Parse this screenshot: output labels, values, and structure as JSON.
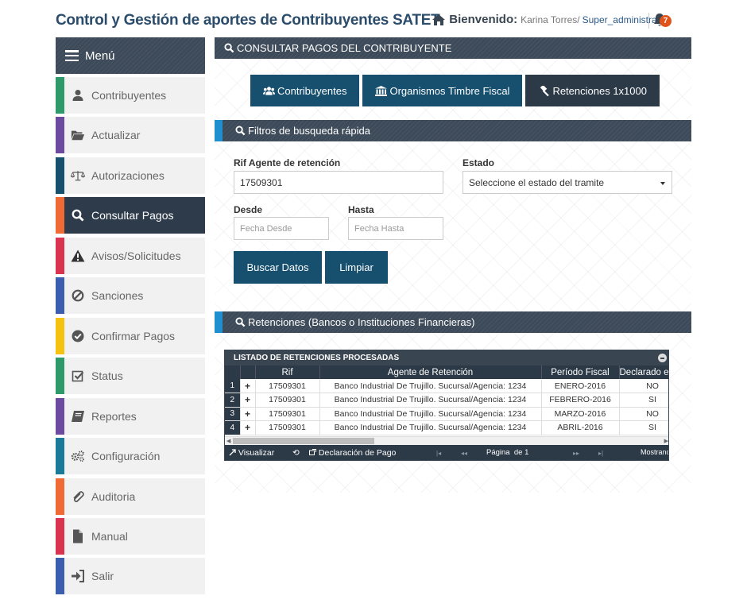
{
  "header": {
    "app_title": "Control y Gestión de aportes de Contribuyentes SATET",
    "welcome": "Bienvenido:",
    "user_name": "Karina Torres/",
    "user_role": "Super_administrador",
    "notifications_count": "7"
  },
  "sidebar": {
    "menu_label": "Menú",
    "items": [
      {
        "label": "Contribuyentes",
        "icon": "user-icon",
        "color": "#2e9a6a"
      },
      {
        "label": "Actualizar",
        "icon": "folder-open-icon",
        "color": "#6b4aa0"
      },
      {
        "label": "Autorizaciones",
        "icon": "balance-scale-icon",
        "color": "#17506f"
      },
      {
        "label": "Consultar Pagos",
        "icon": "search-icon",
        "color": "#f06a35",
        "active": true
      },
      {
        "label": "Avisos/Solicitudes",
        "icon": "warning-icon",
        "color": "#d9334f"
      },
      {
        "label": "Sanciones",
        "icon": "ban-icon",
        "color": "#3b5fae"
      },
      {
        "label": "Confirmar Pagos",
        "icon": "check-circle-icon",
        "color": "#f5c211"
      },
      {
        "label": "Status",
        "icon": "check-square-icon",
        "color": "#2e9a6a"
      },
      {
        "label": "Reportes",
        "icon": "book-icon",
        "color": "#6b4aa0"
      },
      {
        "label": "Configuración",
        "icon": "cogs-icon",
        "color": "#1a7a9a"
      },
      {
        "label": "Auditoria",
        "icon": "paperclip-icon",
        "color": "#f06a35"
      },
      {
        "label": "Manual",
        "icon": "file-icon",
        "color": "#d9334f"
      },
      {
        "label": "Salir",
        "icon": "sign-in-icon",
        "color": "#3b5fae"
      }
    ]
  },
  "main": {
    "title": "CONSULTAR PAGOS DEL CONTRIBUYENTE",
    "tabs": [
      {
        "label": "Contribuyentes",
        "icon": "users-icon"
      },
      {
        "label": "Organismos Timbre Fiscal",
        "icon": "bank-icon"
      },
      {
        "label": "Retenciones 1x1000",
        "icon": "gavel-icon"
      }
    ],
    "filters_title": "Filtros de busqueda rápida",
    "rif_label": "Rif Agente de retención",
    "rif_value": "17509301",
    "estado_label": "Estado",
    "estado_value": "Seleccione el estado del tramite",
    "desde_label": "Desde",
    "desde_placeholder": "Fecha Desde",
    "hasta_label": "Hasta",
    "hasta_placeholder": "Fecha Hasta",
    "search_button": "Buscar Datos",
    "clear_button": "Limpiar",
    "retenciones_title": "Retenciones (Bancos o Instituciones Financieras)"
  },
  "grid": {
    "caption": "LISTADO DE RETENCIONES PROCESADAS",
    "columns": [
      "Rif",
      "Agente de Retención",
      "Período Fiscal",
      "Declarado e"
    ],
    "rows": [
      {
        "n": "1",
        "rif": "17509301",
        "agente": "Banco Industrial De Trujillo. Sucursal/Agencia: 1234",
        "periodo": "ENERO-2016",
        "declarado": "NO"
      },
      {
        "n": "2",
        "rif": "17509301",
        "agente": "Banco Industrial De Trujillo. Sucursal/Agencia: 1234",
        "periodo": "FEBRERO-2016",
        "declarado": "SI"
      },
      {
        "n": "3",
        "rif": "17509301",
        "agente": "Banco Industrial De Trujillo. Sucursal/Agencia: 1234",
        "periodo": "MARZO-2016",
        "declarado": "NO"
      },
      {
        "n": "4",
        "rif": "17509301",
        "agente": "Banco Industrial De Trujillo. Sucursal/Agencia: 1234",
        "periodo": "ABRIL-2016",
        "declarado": "SI"
      }
    ],
    "row_action": "+",
    "pager": {
      "visualizar": "Visualizar",
      "declaracion": "Declaración de Pago",
      "pagina": "Página",
      "de": "de 1",
      "mostrando": "Mostrand"
    }
  }
}
